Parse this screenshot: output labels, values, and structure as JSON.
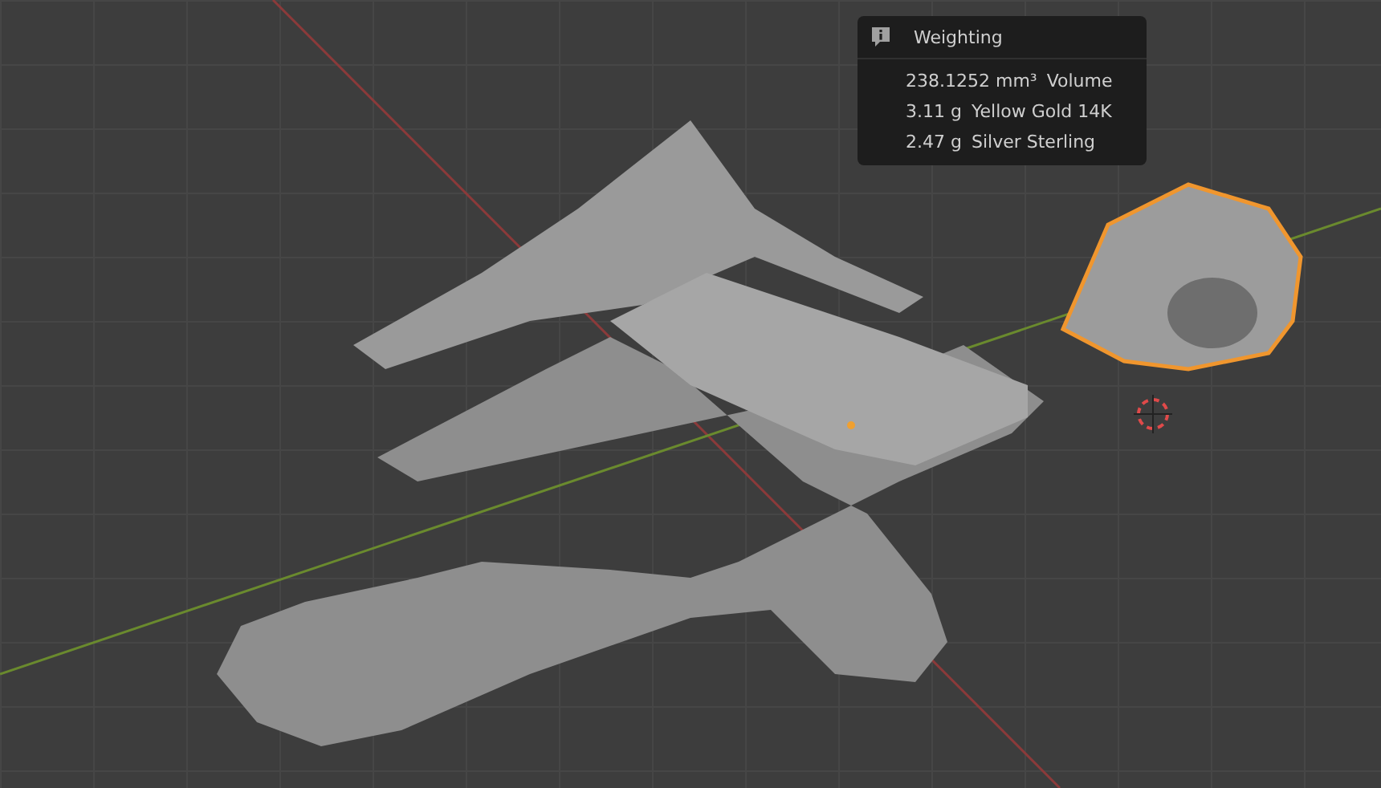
{
  "panel": {
    "title": "Weighting",
    "rows": [
      {
        "amount": "238.1252 mm³",
        "name": "Volume"
      },
      {
        "amount": "3.11 g",
        "name": "Yellow Gold 14K"
      },
      {
        "amount": "2.47 g",
        "name": "Silver Sterling"
      }
    ]
  }
}
